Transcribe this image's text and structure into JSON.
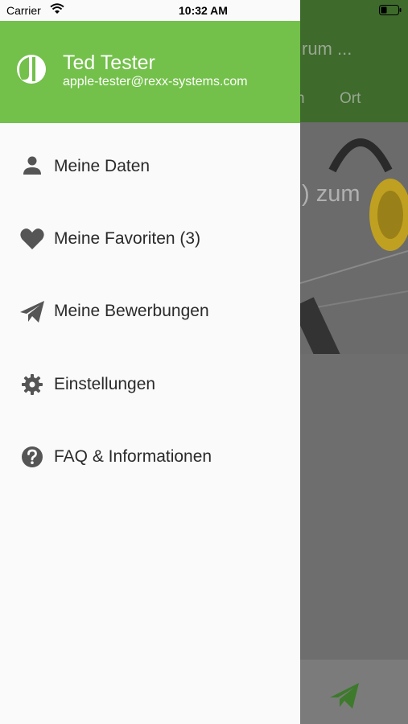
{
  "status_bar": {
    "carrier": "Carrier",
    "time": "10:32 AM"
  },
  "user": {
    "name": "Ted Tester",
    "email": "apple-tester@rexx-systems.com"
  },
  "menu": {
    "items": [
      {
        "label": "Meine Daten",
        "icon": "person-icon"
      },
      {
        "label": "Meine Favoriten (3)",
        "icon": "heart-icon"
      },
      {
        "label": "Meine Bewerbungen",
        "icon": "paper-plane-icon"
      },
      {
        "label": "Einstellungen",
        "icon": "gear-icon"
      },
      {
        "label": "FAQ & Informationen",
        "icon": "help-icon"
      }
    ]
  },
  "background": {
    "title_fragment": "rum ...",
    "tab_fragment": "n",
    "tab_ort": "Ort",
    "hero_fragment": ") zum"
  },
  "colors": {
    "drawer_header": "#73c04a",
    "app_header": "#3e6a2c",
    "icon_gray": "#555555",
    "send_green": "#3d7a2c"
  }
}
